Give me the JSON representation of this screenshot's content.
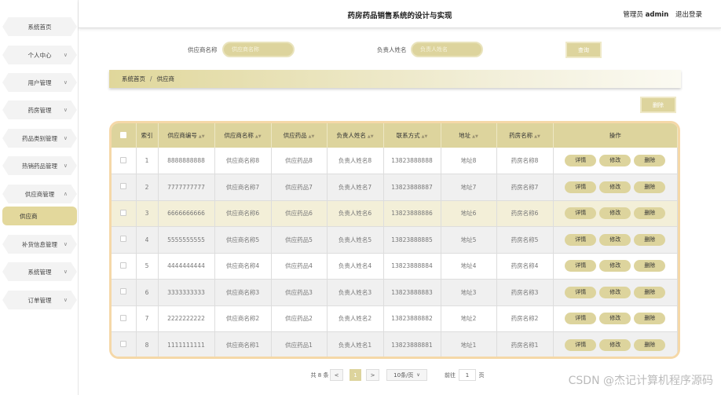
{
  "header": {
    "title": "药房药品销售系统的设计与实现",
    "user_label": "管理员",
    "username": "admin",
    "logout": "退出登录"
  },
  "sidebar": {
    "items": [
      {
        "label": "系统首页",
        "chevron": false
      },
      {
        "label": "个人中心",
        "chevron": true
      },
      {
        "label": "用户管理",
        "chevron": true
      },
      {
        "label": "药房管理",
        "chevron": true
      },
      {
        "label": "药品类别管理",
        "chevron": true
      },
      {
        "label": "热销药品管理",
        "chevron": true
      },
      {
        "label": "供应商管理",
        "chevron": true,
        "expanded": true
      },
      {
        "label": "供应商",
        "active": true
      },
      {
        "label": "补货信息管理",
        "chevron": true
      },
      {
        "label": "系统管理",
        "chevron": true
      },
      {
        "label": "订单管理",
        "chevron": true
      }
    ]
  },
  "search": {
    "supplier_name_label": "供应商名称",
    "supplier_name_placeholder": "供应商名称",
    "contact_label": "负责人姓名",
    "contact_placeholder": "负责人姓名",
    "query_button": "查询"
  },
  "breadcrumb": {
    "home": "系统首页",
    "separator": "/",
    "current": "供应商"
  },
  "toolbar": {
    "delete_button": "删除"
  },
  "table": {
    "columns": [
      "索引",
      "供应商编号",
      "供应商名称",
      "供应药品",
      "负责人姓名",
      "联系方式",
      "地址",
      "药房名称",
      "操作"
    ],
    "actions": {
      "detail": "详情",
      "edit": "修改",
      "delete": "删除"
    },
    "rows": [
      {
        "index": "1",
        "code": "8888888888",
        "name": "供应商名称8",
        "drug": "供应药品8",
        "contact": "负责人姓名8",
        "phone": "13823888888",
        "address": "地址8",
        "pharmacy": "药房名称8"
      },
      {
        "index": "2",
        "code": "7777777777",
        "name": "供应商名称7",
        "drug": "供应药品7",
        "contact": "负责人姓名7",
        "phone": "13823888887",
        "address": "地址7",
        "pharmacy": "药房名称7"
      },
      {
        "index": "3",
        "code": "6666666666",
        "name": "供应商名称6",
        "drug": "供应药品6",
        "contact": "负责人姓名6",
        "phone": "13823888886",
        "address": "地址6",
        "pharmacy": "药房名称6"
      },
      {
        "index": "4",
        "code": "5555555555",
        "name": "供应商名称5",
        "drug": "供应药品5",
        "contact": "负责人姓名5",
        "phone": "13823888885",
        "address": "地址5",
        "pharmacy": "药房名称5"
      },
      {
        "index": "5",
        "code": "4444444444",
        "name": "供应商名称4",
        "drug": "供应药品4",
        "contact": "负责人姓名4",
        "phone": "13823888884",
        "address": "地址4",
        "pharmacy": "药房名称4"
      },
      {
        "index": "6",
        "code": "3333333333",
        "name": "供应商名称3",
        "drug": "供应药品3",
        "contact": "负责人姓名3",
        "phone": "13823888883",
        "address": "地址3",
        "pharmacy": "药房名称3"
      },
      {
        "index": "7",
        "code": "2222222222",
        "name": "供应商名称2",
        "drug": "供应药品2",
        "contact": "负责人姓名2",
        "phone": "13823888882",
        "address": "地址2",
        "pharmacy": "药房名称2"
      },
      {
        "index": "8",
        "code": "1111111111",
        "name": "供应商名称1",
        "drug": "供应药品1",
        "contact": "负责人姓名1",
        "phone": "13823888881",
        "address": "地址1",
        "pharmacy": "药房名称1"
      }
    ]
  },
  "pagination": {
    "total": "共 8 条",
    "prev": "<",
    "current_page": "1",
    "next": ">",
    "page_size": "10条/页",
    "goto_label": "前往",
    "goto_value": "1",
    "page_unit": "页"
  },
  "watermark": "CSDN @杰记计算机程序源码"
}
